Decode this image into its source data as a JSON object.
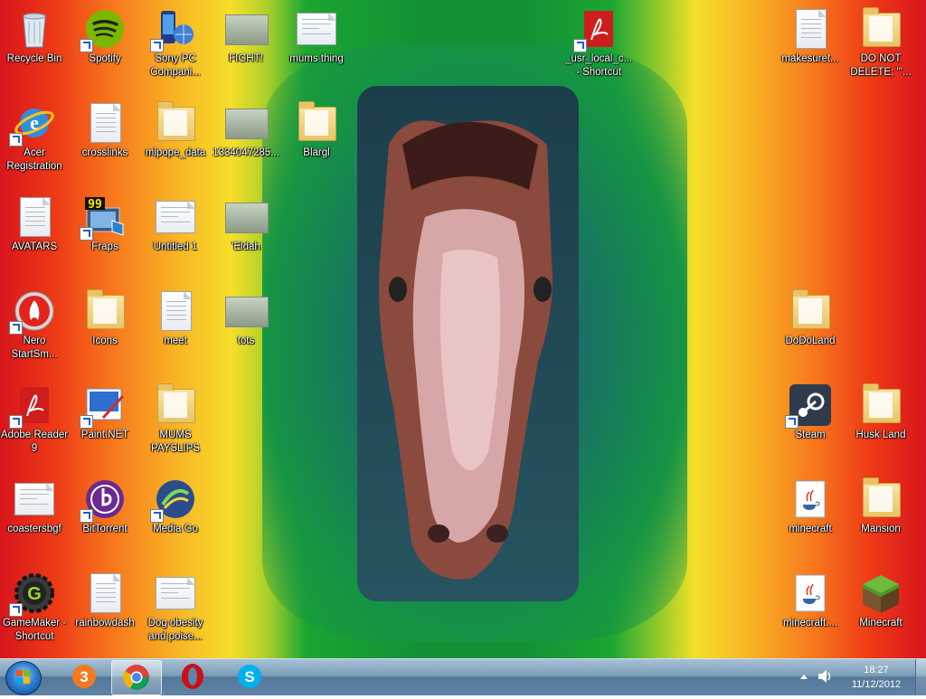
{
  "desktop": {
    "icons": [
      {
        "label": "Recycle Bin",
        "type": "recycle"
      },
      {
        "label": "Spotify",
        "type": "spotify"
      },
      {
        "label": "Sony PC\nCompani...",
        "type": "phone"
      },
      {
        "label": "FIGHT!",
        "type": "image"
      },
      {
        "label": "mums thing",
        "type": "document"
      },
      {
        "label": "_usr_local_c...\n- Shortcut",
        "type": "pdf"
      },
      {
        "label": "makesuret...",
        "type": "text"
      },
      {
        "label": "DO NOT\nDELETE; '''...",
        "type": "folder"
      },
      {
        "label": "Acer\nRegistration",
        "type": "ie"
      },
      {
        "label": "crosslinks",
        "type": "text"
      },
      {
        "label": "mlpope_data",
        "type": "folder"
      },
      {
        "label": "1334047285...",
        "type": "image"
      },
      {
        "label": "Blargl",
        "type": "folder"
      },
      {
        "label": "AVATARS",
        "type": "text"
      },
      {
        "label": "Fraps",
        "type": "fraps"
      },
      {
        "label": "Untitled 1",
        "type": "document"
      },
      {
        "label": "'Eldah",
        "type": "image"
      },
      {
        "label": "Nero\nStartSm...",
        "type": "nero"
      },
      {
        "label": "Icons",
        "type": "folder"
      },
      {
        "label": "meet",
        "type": "text"
      },
      {
        "label": "tots",
        "type": "image"
      },
      {
        "label": "DoDoLand",
        "type": "folder"
      },
      {
        "label": "Adobe Reader\n9",
        "type": "pdf"
      },
      {
        "label": "Paint.NET",
        "type": "paint"
      },
      {
        "label": "MUMS\nPAYSLIPS",
        "type": "folder"
      },
      {
        "label": "Steam",
        "type": "steam"
      },
      {
        "label": "Husk Land",
        "type": "folder"
      },
      {
        "label": "coastersbgf",
        "type": "document"
      },
      {
        "label": "BitTorrent",
        "type": "bittorrent"
      },
      {
        "label": "Media Go",
        "type": "mediago"
      },
      {
        "label": "minecraft",
        "type": "java"
      },
      {
        "label": "Mansion",
        "type": "folder"
      },
      {
        "label": "GameMaker -\nShortcut",
        "type": "gamemaker"
      },
      {
        "label": "rainbowdash",
        "type": "text"
      },
      {
        "label": "Dog obesity\nand poise...",
        "type": "document"
      },
      {
        "label": "minecraft....",
        "type": "java"
      },
      {
        "label": "Minecraft",
        "type": "minecraft"
      }
    ]
  },
  "taskbar": {
    "pinned": [
      {
        "name": "three-mobile-icon"
      },
      {
        "name": "chrome-icon"
      },
      {
        "name": "opera-icon"
      },
      {
        "name": "skype-icon"
      }
    ],
    "tray": {
      "time": "18:27",
      "date": "11/12/2012"
    }
  },
  "colors": {
    "taskbar": "#5e83a4",
    "text": "#ffffff"
  }
}
